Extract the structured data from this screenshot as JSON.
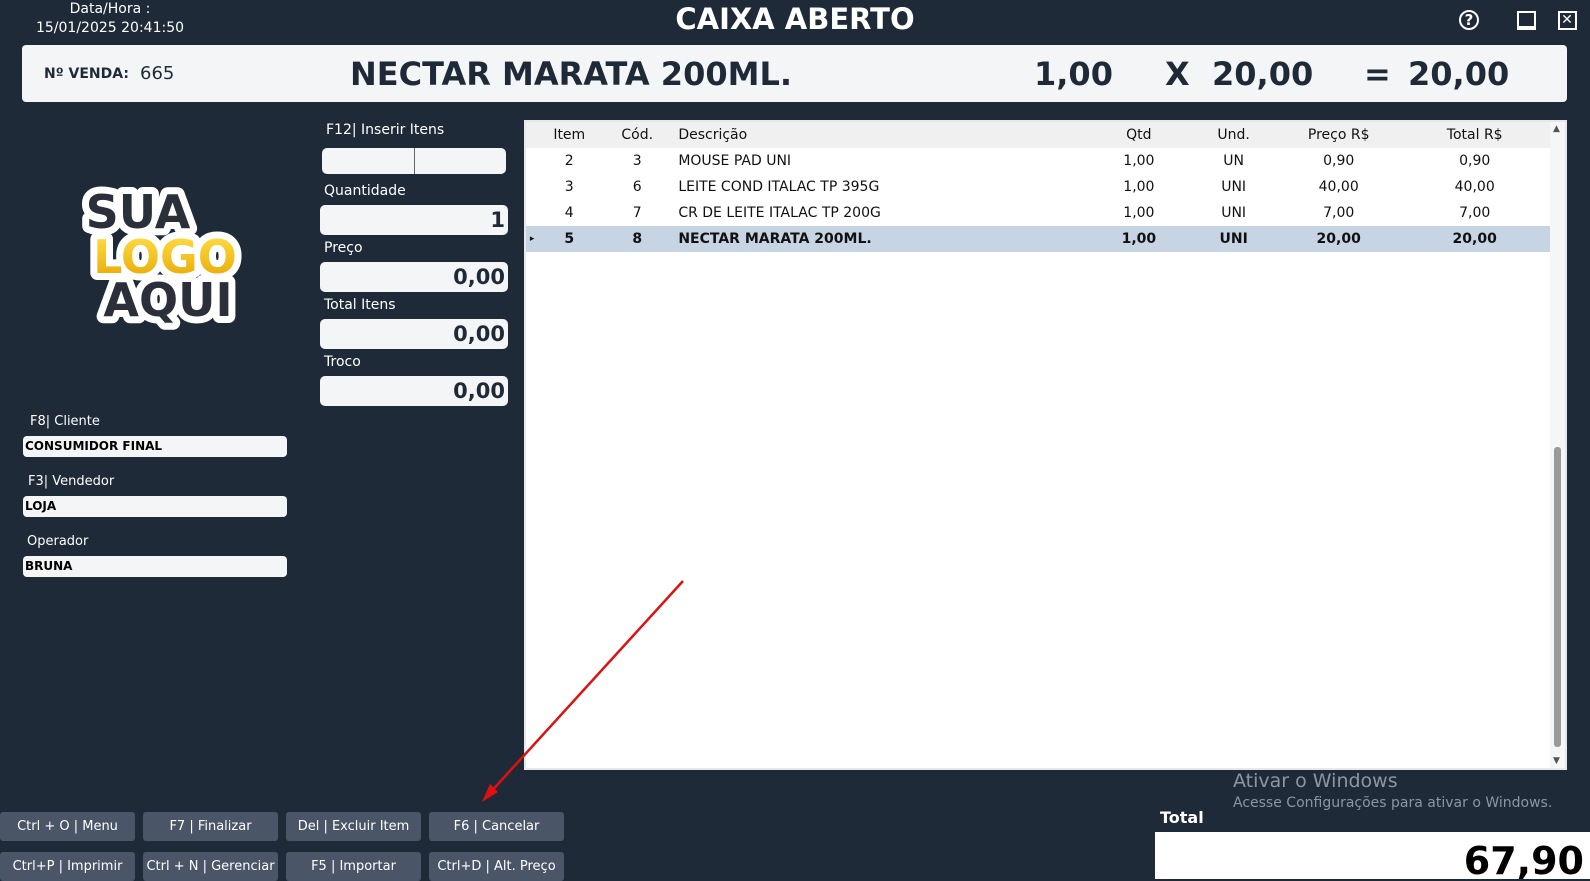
{
  "window": {
    "datetime_label": "Data/Hora :",
    "datetime_value": "15/01/2025 20:41:50",
    "title": "CAIXA ABERTO",
    "help_icon": "question-circle-icon",
    "help_glyph": "?",
    "close_glyph": "✕"
  },
  "header": {
    "sale_label": "Nº VENDA:",
    "sale_number": "665",
    "description": "NECTAR MARATA 200ML.",
    "qty": "1,00",
    "times": "X",
    "price": "20,00",
    "equals": "=",
    "total": "20,00"
  },
  "logo": {
    "line1": "SUA",
    "line2": "LOGO",
    "line3": "AQUI"
  },
  "fields": {
    "insert_label": "F12| Inserir Itens",
    "qty_label": "Quantidade",
    "qty_value": "1",
    "price_label": "Preço",
    "price_value": "0,00",
    "total_items_label": "Total Itens",
    "total_items_value": "0,00",
    "change_label": "Troco",
    "change_value": "0,00"
  },
  "side": {
    "client_label": "F8| Cliente",
    "client_value": "CONSUMIDOR FINAL",
    "seller_label": "F3| Vendedor",
    "seller_value": "LOJA",
    "operator_label": "Operador",
    "operator_value": "BRUNA"
  },
  "grid": {
    "columns": [
      "Item",
      "Cód.",
      "Descrição",
      "Qtd",
      "Und.",
      "Preço R$",
      "Total R$"
    ],
    "rows": [
      [
        "2",
        "3",
        "MOUSE PAD  UNI",
        "1,00",
        "UN",
        "0,90",
        "0,90"
      ],
      [
        "3",
        "6",
        "LEITE COND ITALAC TP 395G",
        "1,00",
        "UNI",
        "40,00",
        "40,00"
      ],
      [
        "4",
        "7",
        "CR DE LEITE ITALAC TP 200G",
        "1,00",
        "UNI",
        "7,00",
        "7,00"
      ],
      [
        "5",
        "8",
        "NECTAR MARATA 200ML.",
        "1,00",
        "UNI",
        "20,00",
        "20,00"
      ]
    ],
    "selected_row": 3
  },
  "buttons": {
    "menu": "Ctrl + O | Menu",
    "finalize": "F7 | Finalizar",
    "delete_item": "Del | Excluir Item",
    "cancel": "F6 | Cancelar",
    "print": "Ctrl+P | Imprimir",
    "manage": "Ctrl + N | Gerenciar",
    "import": "F5 | Importar",
    "alt_price": "Ctrl+D | Alt. Preço"
  },
  "total": {
    "label": "Total",
    "value": "67,90"
  },
  "watermark": {
    "line1": "Ativar o Windows",
    "line2": "Acesse Configurações para ativar o Windows."
  },
  "colors": {
    "background": "#1f2a38",
    "button": "#4a5568",
    "selected_row": "#c6d4e3",
    "annotation_arrow": "#e01010"
  }
}
